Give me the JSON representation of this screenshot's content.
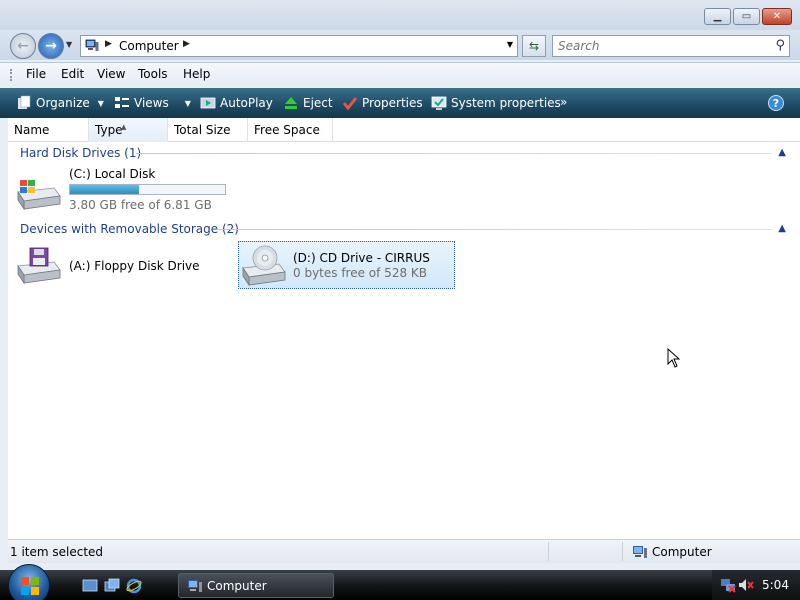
{
  "window": {
    "controls": [
      "minimize",
      "maximize",
      "close"
    ]
  },
  "navigation": {
    "breadcrumb": "Computer",
    "search_placeholder": "Search"
  },
  "menu": [
    "File",
    "Edit",
    "View",
    "Tools",
    "Help"
  ],
  "toolbar": {
    "organize": "Organize",
    "views": "Views",
    "autoplay": "AutoPlay",
    "eject": "Eject",
    "properties": "Properties",
    "system_properties": "System properties",
    "more": "»"
  },
  "columns": [
    "Name",
    "Type",
    "Total Size",
    "Free Space"
  ],
  "groups": {
    "hard_disks": {
      "title": "Hard Disk Drives (1)",
      "drives": [
        {
          "label": "(C:) Local Disk",
          "free_text": "3.80 GB free of 6.81 GB",
          "used_fraction": 0.442
        }
      ]
    },
    "removable": {
      "title": "Devices with Removable Storage (2)",
      "drives": [
        {
          "label": "(A:) Floppy Disk Drive"
        },
        {
          "label": "(D:) CD Drive - CIRRUS",
          "free_text": "0 bytes free of 528 KB",
          "selected": true
        }
      ]
    }
  },
  "status": {
    "left": "1 item selected",
    "right": "Computer"
  },
  "taskbar": {
    "task": "Computer",
    "clock": "5:04"
  },
  "colors": {
    "group_heading": "#1e3f8c",
    "command_bar": "#1f4c66",
    "progress_fill": "#2a8fc5"
  }
}
